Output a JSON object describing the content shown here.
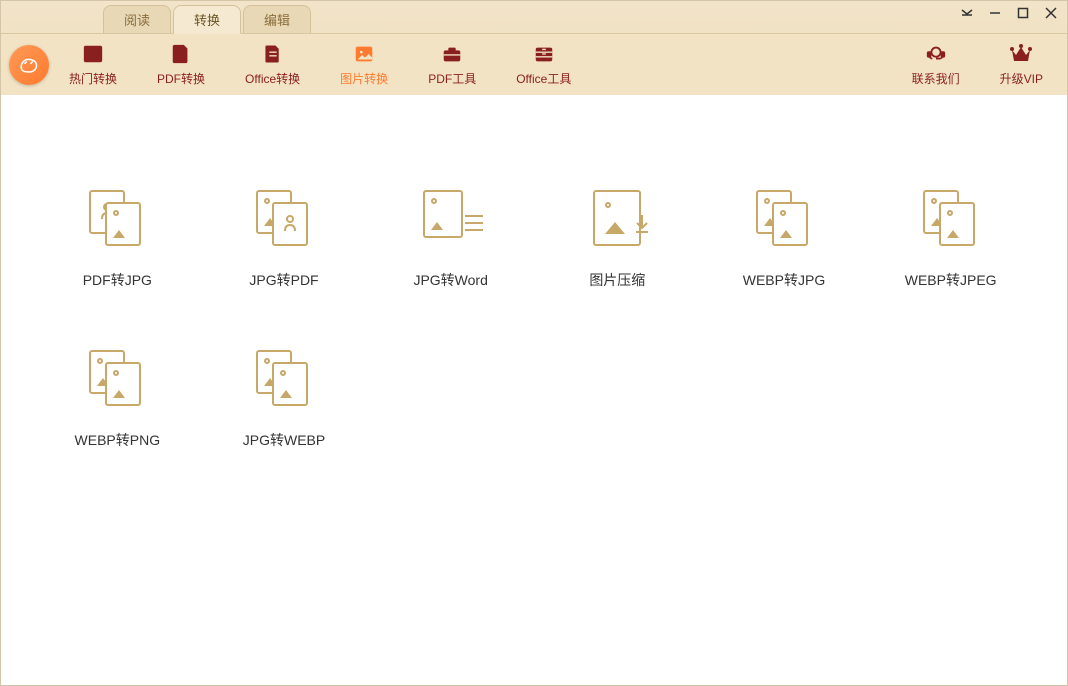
{
  "tabs": [
    {
      "label": "阅读",
      "active": false
    },
    {
      "label": "转换",
      "active": true
    },
    {
      "label": "编辑",
      "active": false
    }
  ],
  "toolbar": [
    {
      "id": "hot",
      "label": "热门转换"
    },
    {
      "id": "pdf",
      "label": "PDF转换"
    },
    {
      "id": "office",
      "label": "Office转换"
    },
    {
      "id": "image",
      "label": "图片转换",
      "active": true
    },
    {
      "id": "pdftool",
      "label": "PDF工具"
    },
    {
      "id": "officetool",
      "label": "Office工具"
    }
  ],
  "right_actions": {
    "contact": "联系我们",
    "vip": "升级VIP"
  },
  "tools": [
    {
      "label": "PDF转JPG"
    },
    {
      "label": "JPG转PDF"
    },
    {
      "label": "JPG转Word"
    },
    {
      "label": "图片压缩"
    },
    {
      "label": "WEBP转JPG"
    },
    {
      "label": "WEBP转JPEG"
    },
    {
      "label": "WEBP转PNG"
    },
    {
      "label": "JPG转WEBP"
    }
  ]
}
